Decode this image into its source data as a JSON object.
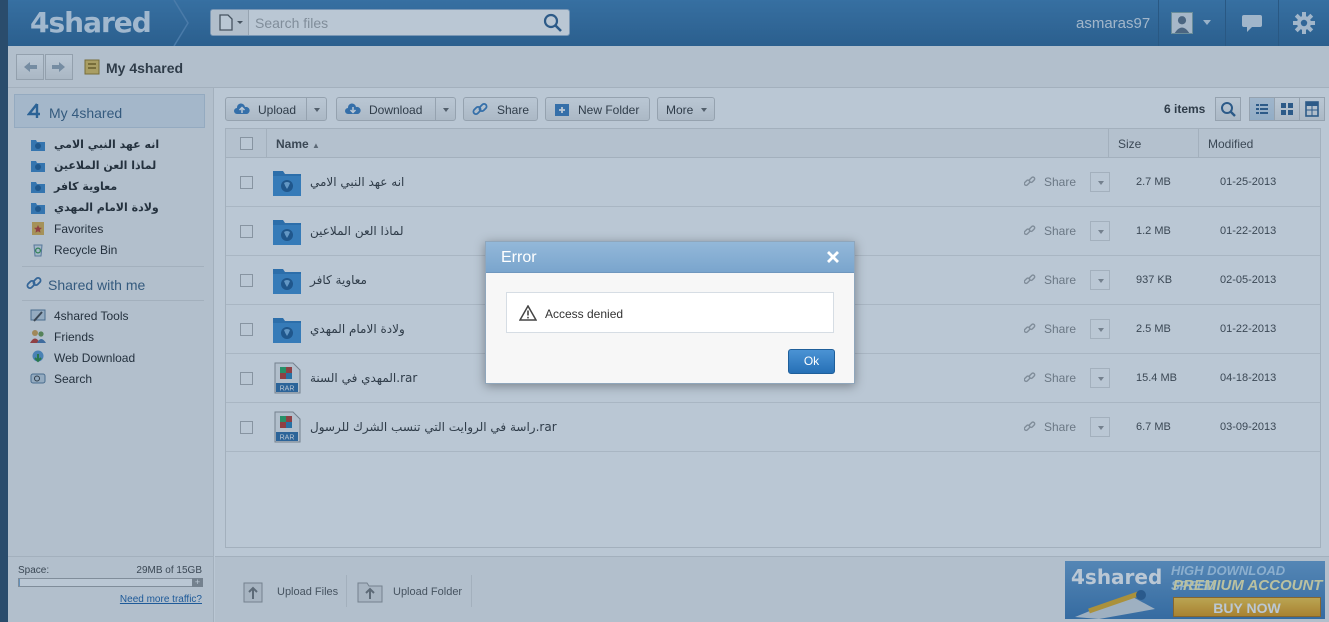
{
  "header": {
    "logo": "4shared",
    "search_placeholder": "Search files",
    "username": "asmaras97"
  },
  "breadcrumb": {
    "title": "My 4shared"
  },
  "sidebar": {
    "my_title": "My 4shared",
    "folders": [
      {
        "label": "انه عهد النبي الامي"
      },
      {
        "label": "لماذا العن الملاعين"
      },
      {
        "label": "معاوية كافر"
      },
      {
        "label": "ولادة الامام المهدي"
      }
    ],
    "favorites": "Favorites",
    "recycle_bin": "Recycle Bin",
    "shared_title": "Shared with me",
    "tools": "4shared Tools",
    "friends": "Friends",
    "web_download": "Web Download",
    "search": "Search",
    "space_label": "Space:",
    "space_value": "29MB of 15GB",
    "space_used_fraction": 0.002,
    "more_traffic": "Need more traffic?"
  },
  "toolbar": {
    "upload": "Upload",
    "download": "Download",
    "share": "Share",
    "new_folder": "New Folder",
    "more": "More",
    "items_count": "6 items"
  },
  "table": {
    "col_name": "Name",
    "col_size": "Size",
    "col_modified": "Modified",
    "share_label": "Share",
    "rows": [
      {
        "name": "انه عهد النبي الامي",
        "type": "folder",
        "size": "2.7 MB",
        "modified": "01-25-2013"
      },
      {
        "name": "لماذا العن الملاعين",
        "type": "folder",
        "size": "1.2 MB",
        "modified": "01-22-2013"
      },
      {
        "name": "معاوية كافر",
        "type": "folder",
        "size": "937 KB",
        "modified": "02-05-2013"
      },
      {
        "name": "ولادة الامام المهدي",
        "type": "folder",
        "size": "2.5 MB",
        "modified": "01-22-2013"
      },
      {
        "name": "المهدي في السنة.rar",
        "type": "rar",
        "size": "15.4 MB",
        "modified": "04-18-2013"
      },
      {
        "name": "راسة في الروايت التي تنسب الشرك للرسول.rar",
        "type": "rar",
        "size": "6.7 MB",
        "modified": "03-09-2013"
      }
    ]
  },
  "bottom": {
    "upload_files": "Upload Files",
    "upload_folder": "Upload Folder",
    "promo_logo": "4shared",
    "promo_line1": "HIGH DOWNLOAD SPEED",
    "promo_line2": "PREMIUM ACCOUNT",
    "promo_buy": "BUY NOW"
  },
  "dialog": {
    "title": "Error",
    "message": "Access denied",
    "ok": "Ok"
  }
}
